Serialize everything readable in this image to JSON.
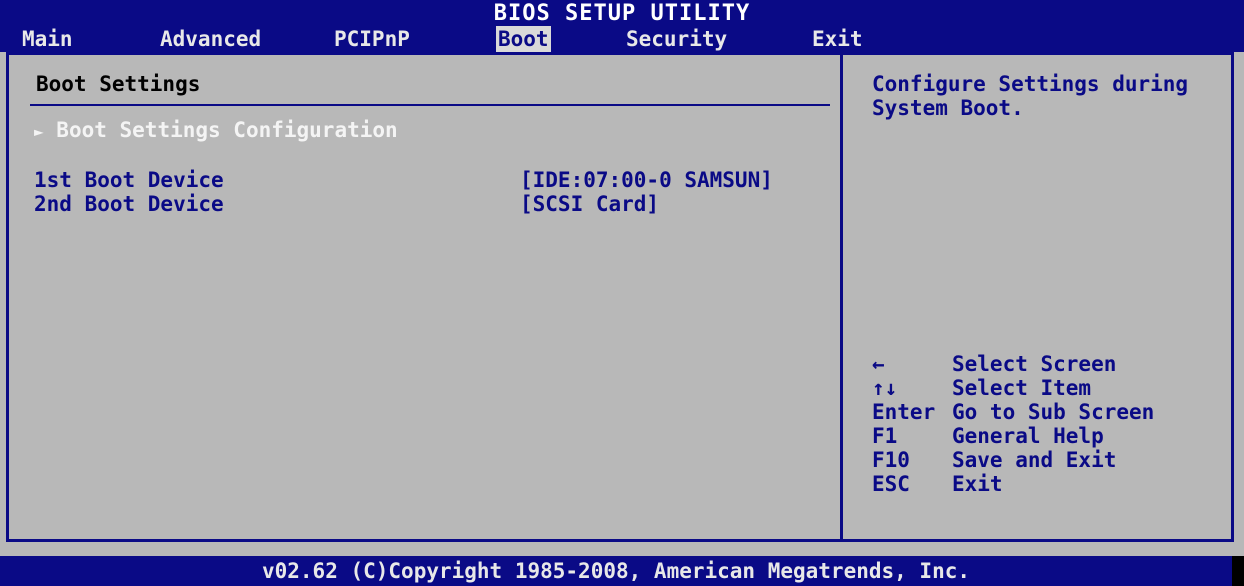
{
  "header": {
    "title": "BIOS SETUP UTILITY",
    "tabs": [
      {
        "label": "Main"
      },
      {
        "label": "Advanced"
      },
      {
        "label": "PCIPnP"
      },
      {
        "label": "Boot"
      },
      {
        "label": "Security"
      },
      {
        "label": "Exit"
      }
    ],
    "active_tab": "Boot"
  },
  "main": {
    "section_title": "Boot Settings",
    "submenu": {
      "arrow": "►",
      "label": "Boot Settings Configuration"
    },
    "items": [
      {
        "label": "1st Boot Device",
        "value": "[IDE:07:00-0 SAMSUN]"
      },
      {
        "label": "2nd Boot Device",
        "value": "[SCSI Card]"
      }
    ]
  },
  "help": {
    "text": "Configure Settings during System Boot.",
    "keys": [
      {
        "key": "←",
        "desc": "Select Screen"
      },
      {
        "key": "↑↓",
        "desc": "Select Item"
      },
      {
        "key": "Enter",
        "desc": "Go to Sub Screen"
      },
      {
        "key": "F1",
        "desc": "General Help"
      },
      {
        "key": "F10",
        "desc": "Save and Exit"
      },
      {
        "key": "ESC",
        "desc": "Exit"
      }
    ]
  },
  "footer": {
    "copyright": "v02.62 (C)Copyright 1985-2008, American Megatrends, Inc."
  },
  "colors": {
    "bar": "#0a0a86",
    "panel": "#b8b8b8",
    "active_tab_bg": "#d9d9d9",
    "submenu_text": "#f4f4f4"
  }
}
